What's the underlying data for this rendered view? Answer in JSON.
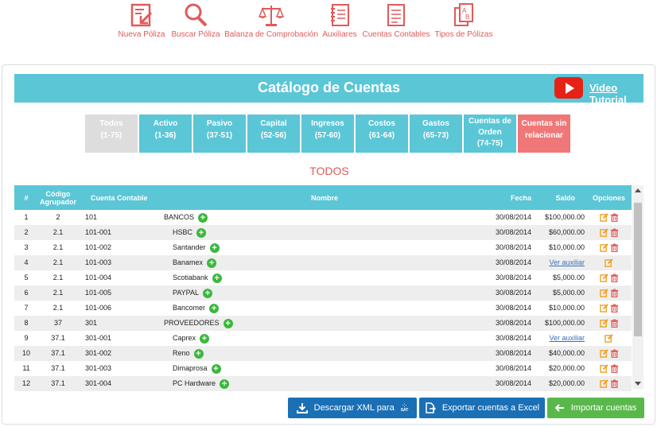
{
  "toolbar": [
    {
      "name": "nueva-poliza",
      "label": "Nueva Póliza"
    },
    {
      "name": "buscar-poliza",
      "label": "Buscar Póliza"
    },
    {
      "name": "balanza",
      "label": "Balanza de Comprobación"
    },
    {
      "name": "auxiliares",
      "label": "Auxiliares"
    },
    {
      "name": "cuentas-contables",
      "label": "Cuentas Contables"
    },
    {
      "name": "tipos-polizas",
      "label": "Tipos de Pólizas"
    }
  ],
  "header": {
    "title": "Catálogo de Cuentas",
    "video_link": "Video Tutorial"
  },
  "tabs": [
    {
      "label": "Todos",
      "range": "(1-75)",
      "state": "active"
    },
    {
      "label": "Activo",
      "range": "(1-36)"
    },
    {
      "label": "Pasivo",
      "range": "(37-51)"
    },
    {
      "label": "Capital",
      "range": "(52-56)"
    },
    {
      "label": "Ingresos",
      "range": "(57-60)"
    },
    {
      "label": "Costos",
      "range": "(61-64)"
    },
    {
      "label": "Gastos",
      "range": "(65-73)"
    },
    {
      "label": "Cuentas de Orden",
      "range": "(74-75)"
    },
    {
      "label": "Cuentas sin relacionar",
      "range": "",
      "state": "red"
    }
  ],
  "section_title": "TODOS",
  "table": {
    "headers": {
      "num": "#",
      "codigo": "Código Agrupador",
      "cuenta": "Cuenta Contable",
      "nombre": "Nombre",
      "fecha": "Fecha",
      "saldo": "Saldo",
      "opciones": "Opciones"
    },
    "rows": [
      {
        "num": "1",
        "codigo": "2",
        "cuenta": "101",
        "nombre": "BANCOS",
        "level": 0,
        "fecha": "30/08/2014",
        "saldo": "$100,000.00",
        "opts": "edit-delete"
      },
      {
        "num": "2",
        "codigo": "2.1",
        "cuenta": "101-001",
        "nombre": "HSBC",
        "level": 1,
        "fecha": "30/08/2014",
        "saldo": "$60,000.00",
        "opts": "edit-delete"
      },
      {
        "num": "3",
        "codigo": "2.1",
        "cuenta": "101-002",
        "nombre": "Santander",
        "level": 1,
        "fecha": "30/08/2014",
        "saldo": "$10,000.00",
        "opts": "edit-delete"
      },
      {
        "num": "4",
        "codigo": "2.1",
        "cuenta": "101-003",
        "nombre": "Banamex",
        "level": 1,
        "fecha": "30/08/2014",
        "saldo": "Ver auxiliar",
        "link": true,
        "opts": "edit"
      },
      {
        "num": "5",
        "codigo": "2.1",
        "cuenta": "101-004",
        "nombre": "Scotiabank",
        "level": 1,
        "fecha": "30/08/2014",
        "saldo": "$5,000.00",
        "opts": "edit-delete"
      },
      {
        "num": "6",
        "codigo": "2.1",
        "cuenta": "101-005",
        "nombre": "PAYPAL",
        "level": 1,
        "fecha": "30/08/2014",
        "saldo": "$5,000.00",
        "opts": "edit-delete"
      },
      {
        "num": "7",
        "codigo": "2.1",
        "cuenta": "101-006",
        "nombre": "Bancomer",
        "level": 1,
        "fecha": "30/08/2014",
        "saldo": "$10,000.00",
        "opts": "edit-delete"
      },
      {
        "num": "8",
        "codigo": "37",
        "cuenta": "301",
        "nombre": "PROVEEDORES",
        "level": 0,
        "fecha": "30/08/2014",
        "saldo": "$100,000.00",
        "opts": "edit-delete"
      },
      {
        "num": "9",
        "codigo": "37.1",
        "cuenta": "301-001",
        "nombre": "Caprex",
        "level": 1,
        "fecha": "30/08/2014",
        "saldo": "Ver auxiliar",
        "link": true,
        "opts": "edit"
      },
      {
        "num": "10",
        "codigo": "37.1",
        "cuenta": "301-002",
        "nombre": "Reno",
        "level": 1,
        "fecha": "30/08/2014",
        "saldo": "$40,000.00",
        "opts": "edit-delete"
      },
      {
        "num": "11",
        "codigo": "37.1",
        "cuenta": "301-003",
        "nombre": "Dimaprosa",
        "level": 1,
        "fecha": "30/08/2014",
        "saldo": "$20,000.00",
        "opts": "edit-delete"
      },
      {
        "num": "12",
        "codigo": "37.1",
        "cuenta": "301-004",
        "nombre": "PC Hardware",
        "level": 1,
        "fecha": "30/08/2014",
        "saldo": "$20,000.00",
        "opts": "edit-delete"
      }
    ]
  },
  "buttons": {
    "descargar": "Descargar XML para",
    "exportar": "Exportar cuentas a Excel",
    "importar": "Importar cuentas"
  },
  "icons": {
    "sat_label": "SAT"
  },
  "colors": {
    "accent": "#5bc6d6",
    "red": "#e05a5a",
    "green": "#5ab84b",
    "blue": "#1a6fb5"
  }
}
